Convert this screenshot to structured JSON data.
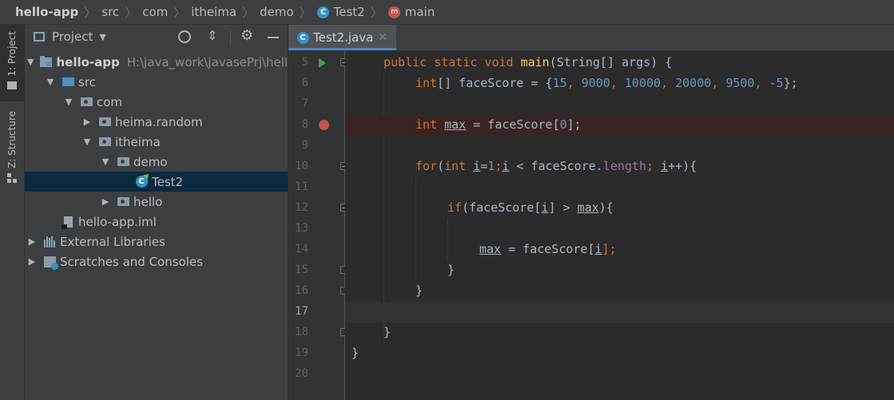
{
  "breadcrumb": {
    "items": [
      "hello-app",
      "src",
      "com",
      "itheima",
      "demo",
      "Test2",
      "main"
    ]
  },
  "toolstrip": {
    "project_tab": "1: Project",
    "structure_tab": "Z: Structure"
  },
  "project_panel": {
    "title": "Project",
    "tree": [
      {
        "label": "hello-app",
        "hint": "H:\\java_work\\javasePrj\\hello"
      },
      {
        "label": "src"
      },
      {
        "label": "com"
      },
      {
        "label": "heima.random"
      },
      {
        "label": "itheima"
      },
      {
        "label": "demo"
      },
      {
        "label": "Test2"
      },
      {
        "label": "hello"
      },
      {
        "label": "hello-app.iml"
      },
      {
        "label": "External Libraries"
      },
      {
        "label": "Scratches and Consoles"
      }
    ]
  },
  "editor": {
    "tab_label": "Test2.java",
    "line_numbers": [
      "5",
      "6",
      "7",
      "8",
      "9",
      "10",
      "11",
      "12",
      "13",
      "14",
      "15",
      "16",
      "17",
      "18",
      "19",
      "20"
    ],
    "current_line": "17",
    "code": {
      "l5": {
        "t1": "public static void ",
        "t2": "main",
        "t3": "(String[] args) {"
      },
      "l6": {
        "t1": "int",
        "t2": "[] faceScore = {",
        "n1": "15",
        "c1": ", ",
        "n2": "9000",
        "c2": ", ",
        "n3": "10000",
        "c3": ", ",
        "n4": "20000",
        "c4": ", ",
        "n5": "9500",
        "c5": ", ",
        "n6": "-5",
        "t3": "};"
      },
      "l8": {
        "t1": "int ",
        "t2": "max",
        "t3": " = faceScore[",
        "n1": "0",
        "t4": "];"
      },
      "l10": {
        "t1": "for",
        "t2": "(",
        "t3": "int ",
        "t4": "i",
        "t5": "=",
        "n1": "1",
        "t6": ";",
        "t7": "i",
        "t8": " < faceScore.",
        "t9": "length",
        "t10": "; ",
        "t11": "i",
        "t12": "++){"
      },
      "l12": {
        "t1": "if",
        "t2": "(faceScore[",
        "t3": "i",
        "t4": "] > ",
        "t5": "max",
        "t6": "){"
      },
      "l14": {
        "t1": "max",
        "t2": " = faceScore[",
        "t3": "i",
        "t4": "];"
      },
      "l15": "}",
      "l16": "}",
      "l18": "}",
      "l19": "}"
    }
  },
  "colors": {
    "keyword": "#cc7832",
    "method": "#ffc66d",
    "number": "#6897bb",
    "field": "#9876aa",
    "text": "#a9b7c6"
  }
}
